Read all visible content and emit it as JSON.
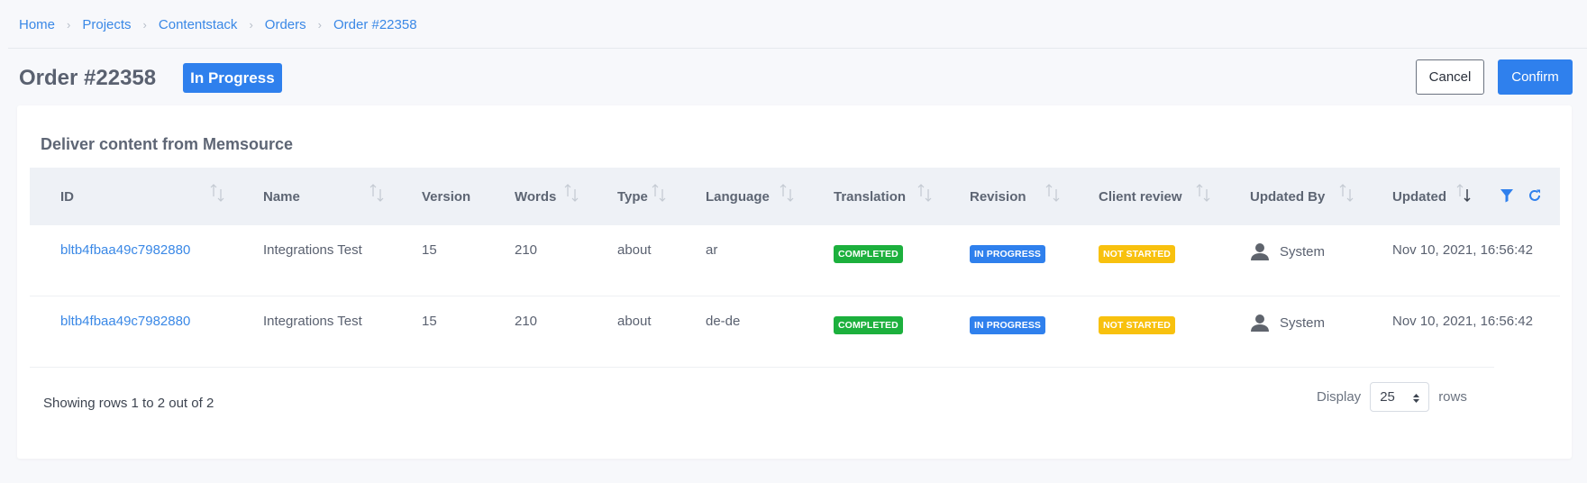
{
  "breadcrumb": [
    "Home",
    "Projects",
    "Contentstack",
    "Orders",
    "Order #22358"
  ],
  "page": {
    "title": "Order #22358",
    "status": "In Progress",
    "cancel_label": "Cancel",
    "confirm_label": "Confirm"
  },
  "card": {
    "title": "Deliver content from Memsource"
  },
  "table": {
    "columns": [
      "ID",
      "Name",
      "Version",
      "Words",
      "Type",
      "Language",
      "Translation",
      "Revision",
      "Client review",
      "Updated By",
      "Updated"
    ],
    "rows": [
      {
        "id": "bltb4fbaa49c7982880",
        "name": "Integrations Test",
        "version": "15",
        "words": "210",
        "type": "about",
        "language": "ar",
        "translation": "COMPLETED",
        "revision": "IN PROGRESS",
        "client_review": "NOT STARTED",
        "updated_by": "System",
        "updated": "Nov 10, 2021, 16:56:42"
      },
      {
        "id": "bltb4fbaa49c7982880",
        "name": "Integrations Test",
        "version": "15",
        "words": "210",
        "type": "about",
        "language": "de-de",
        "translation": "COMPLETED",
        "revision": "IN PROGRESS",
        "client_review": "NOT STARTED",
        "updated_by": "System",
        "updated": "Nov 10, 2021, 16:56:42"
      }
    ]
  },
  "footer": {
    "summary": "Showing rows 1 to 2 out of 2",
    "display_label": "Display",
    "page_size": "25",
    "rows_label": "rows"
  },
  "colors": {
    "accent": "#2f80ed",
    "completed": "#1cb03d",
    "in_progress": "#2f80ed",
    "not_started": "#f8c10e"
  },
  "icons": {
    "breadcrumb_separator": "chevron-right-icon",
    "sort": "sort-arrows-icon",
    "filter": "filter-icon",
    "refresh": "refresh-icon",
    "user": "user-icon",
    "select": "caret-up-down-icon"
  }
}
